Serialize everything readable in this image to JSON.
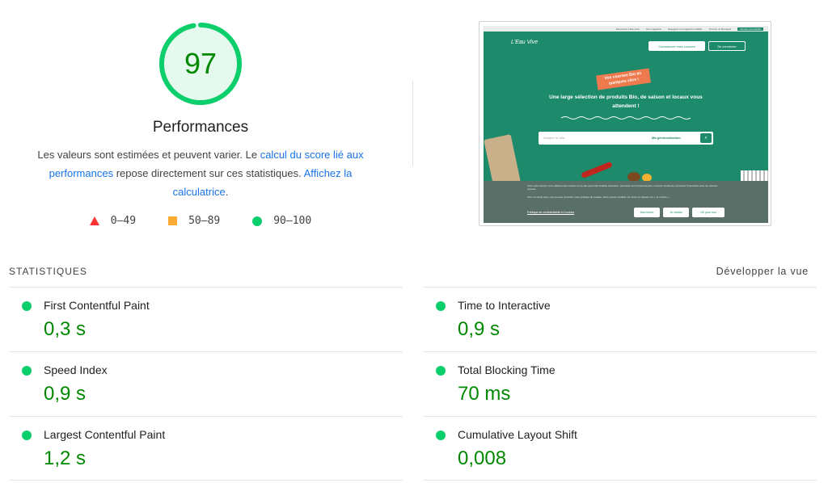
{
  "performance": {
    "score": "97",
    "score_fraction": 0.97,
    "title": "Performances",
    "desc_before": "Les valeurs sont estimées et peuvent varier. Le ",
    "desc_link1": "calcul du score lié aux performances",
    "desc_middle": " repose directement sur ces statistiques. ",
    "desc_link2": "Affichez la calculatrice",
    "desc_end": "."
  },
  "legend": [
    {
      "range": "0–49",
      "shape": "triangle",
      "color": "#ff3333"
    },
    {
      "range": "50–89",
      "shape": "square",
      "color": "#ffaa33"
    },
    {
      "range": "90–100",
      "shape": "circle",
      "color": "#0cce6b"
    }
  ],
  "thumbnail": {
    "topbar_items": [
      "Découvrez L'Eau Vive",
      "Nos magasins",
      "Rejoignez le programme fidélité",
      "Trouvez un Bio'rejets",
      "Service commande"
    ],
    "logo": "L'Eau Vive",
    "btn_primary": "Commencer mes courses",
    "btn_secondary": "Se connecter",
    "tag": "Vos courses Bio en quelques clics !",
    "hero_text": "Une large sélection de produits Bio, de saison et locaux vous attendent !",
    "search_placeholder": "Intégrer la ville...",
    "search_geo": "Ma géolocalisation",
    "cookie_text_1": "Avec votre accord, nous utilisons des cookies sur le site ayant des finalités suivantes : permettre son fonctionnement, mesurer l'audience, permettre l'interaction avec les réseaux sociaux.",
    "cookie_text_2": "Pour en savoir plus, vous pouvez consulter notre politique de cookies. Vous pouvez modifier vos choix en cliquant sur « Je choisis ».",
    "cookie_link": "Politique de confidentialité et Cookies",
    "cookie_btn_1": "Non merci",
    "cookie_btn_2": "Je choisis",
    "cookie_btn_3": "OK pour moi"
  },
  "statistics": {
    "heading": "STATISTIQUES",
    "expand_label": "Développer la vue",
    "left": [
      {
        "label": "First Contentful Paint",
        "value": "0,3 s"
      },
      {
        "label": "Speed Index",
        "value": "0,9 s"
      },
      {
        "label": "Largest Contentful Paint",
        "value": "1,2 s"
      }
    ],
    "right": [
      {
        "label": "Time to Interactive",
        "value": "0,9 s"
      },
      {
        "label": "Total Blocking Time",
        "value": "70 ms"
      },
      {
        "label": "Cumulative Layout Shift",
        "value": "0,008"
      }
    ],
    "status_color": "#0cce6b",
    "value_color": "#008800"
  }
}
